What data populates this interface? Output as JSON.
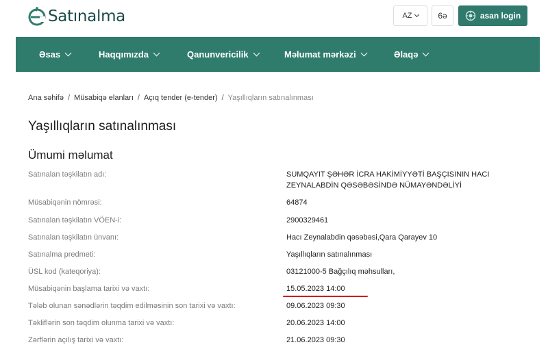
{
  "header": {
    "logo_text": "Satınalma",
    "language": "AZ",
    "accessibility_label": "6ə",
    "login_label": "asan login"
  },
  "nav": {
    "items": [
      {
        "label": "Əsas"
      },
      {
        "label": "Haqqımızda"
      },
      {
        "label": "Qanunvericilik"
      },
      {
        "label": "Məlumat mərkəzi"
      },
      {
        "label": "Əlaqə"
      }
    ]
  },
  "breadcrumb": {
    "items": [
      "Ana səhifə",
      "Müsabiqə elanları",
      "Açıq tender (e-tender)"
    ],
    "current": "Yaşıllıqların satınalınması"
  },
  "page": {
    "title": "Yaşıllıqların satınalınması",
    "section_title": "Ümumi məlumat"
  },
  "details": [
    {
      "label": "Satınalan təşkilatın adı:",
      "value_line1": "SUMQAYIT ŞƏHƏR İCRA HAKİMİYYƏTİ BAŞÇISININ HACI",
      "value_line2": "ZEYNALABDİN QƏSƏBƏSİNDƏ NÜMAYƏNDƏLİYİ"
    },
    {
      "label": "Müsabiqənin nömrəsi:",
      "value": "64874"
    },
    {
      "label": "Satınalan təşkilatın VÖEN-i:",
      "value": "2900329461"
    },
    {
      "label": "Satınalan təşkilatın ünvanı:",
      "value": "Hacı Zeynalabdin qəsəbəsi,Qara Qarayev 10"
    },
    {
      "label": "Satınalma predmeti:",
      "value": "Yaşıllıqların satınalınması"
    },
    {
      "label": "ÜSL kod (kateqoriya):",
      "value": "03121000-5 Bağçılıq məhsulları,"
    },
    {
      "label": "Müsabiqənin başlama tarixi və vaxtı:",
      "value": "15.05.2023 14:00"
    },
    {
      "label": "Tələb olunan sənədlərin təqdim edilməsinin son tarixi və vaxtı:",
      "value": "09.06.2023 09:30"
    },
    {
      "label": "Təkliflərin son təqdim olunma tarixi və vaxtı:",
      "value": "20.06.2023 14:00"
    },
    {
      "label": "Zərflərin açılış tarixi və vaxtı:",
      "value": "21.06.2023 09:30"
    }
  ],
  "colors": {
    "brand": "#2f7c6d",
    "highlight_underline": "#c81e1e"
  }
}
